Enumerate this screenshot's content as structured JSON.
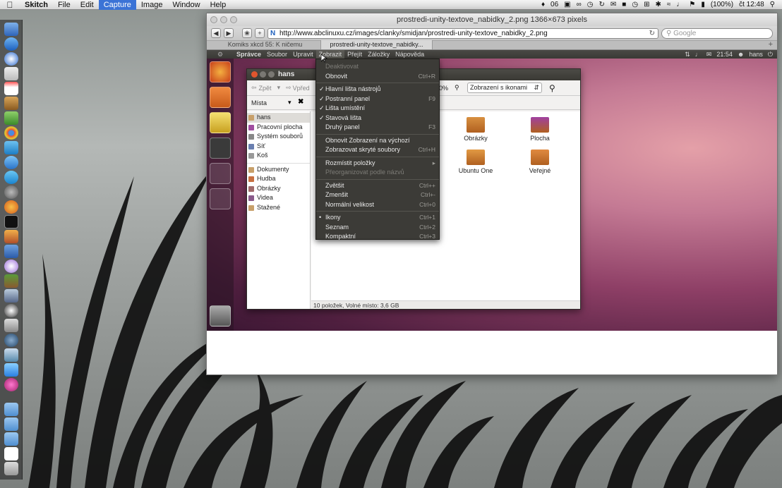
{
  "mac_menubar": {
    "app_name": "Skitch",
    "items": [
      "File",
      "Edit",
      "Capture",
      "Image",
      "Window",
      "Help"
    ],
    "active_item": "Capture",
    "status_battery": "(100%)",
    "status_time": "čt 12:48",
    "status_count": "06"
  },
  "browser": {
    "window_title": "prostredi-unity-textove_nabidky_2.png 1366×673 pixels",
    "url": "http://www.abclinuxu.cz/images/clanky/smidjan/prostredi-unity-textove_nabidky_2.png",
    "search_placeholder": "Google",
    "tabs": [
      {
        "label": "Komiks xkcd 55: K ničemu"
      },
      {
        "label": "prostredi-unity-textove_nabidky..."
      }
    ]
  },
  "ubuntu": {
    "panel_menus": [
      "Správce",
      "Soubor",
      "Upravit",
      "Zobrazit",
      "Přejít",
      "Záložky",
      "Nápověda"
    ],
    "panel_time": "21:54",
    "panel_user": "hans",
    "window_title": "hans",
    "toolbar": {
      "back": "Zpět",
      "forward": "Vpřed",
      "zoom": "100%",
      "view_mode": "Zobrazení s ikonami"
    },
    "sidebar_header": "Místa",
    "sidebar_items_top": [
      {
        "label": "hans",
        "color": "#c8a06a"
      },
      {
        "label": "Pracovní plocha",
        "color": "#a04da0"
      },
      {
        "label": "Systém souborů",
        "color": "#888"
      },
      {
        "label": "Síť",
        "color": "#6a7fb0"
      },
      {
        "label": "Koš",
        "color": "#999"
      }
    ],
    "sidebar_items_bottom": [
      {
        "label": "Dokumenty",
        "color": "#c8a06a"
      },
      {
        "label": "Hudba",
        "color": "#c87040"
      },
      {
        "label": "Obrázky",
        "color": "#a06a6a"
      },
      {
        "label": "Videa",
        "color": "#8a5a8a"
      },
      {
        "label": "Stažené",
        "color": "#c8a06a"
      }
    ],
    "folders": [
      {
        "label": "Obrázky",
        "color": "#d89040"
      },
      {
        "label": "Plocha",
        "color": "#a040a0"
      },
      {
        "label": "Ubuntu One",
        "color": "#e29a44"
      },
      {
        "label": "Veřejné",
        "color": "#e08a40"
      }
    ],
    "status": "10 položek, Volné místo: 3,6 GB",
    "menu": [
      {
        "label": "Deaktivovat",
        "shortcut": "",
        "mark": "",
        "disabled": true
      },
      {
        "label": "Obnovit",
        "shortcut": "Ctrl+R",
        "mark": "",
        "disabled": false
      },
      {
        "sep": true
      },
      {
        "label": "Hlavní lišta nástrojů",
        "shortcut": "",
        "mark": "✓",
        "disabled": false
      },
      {
        "label": "Postranní panel",
        "shortcut": "F9",
        "mark": "✓",
        "disabled": false
      },
      {
        "label": "Lišta umístění",
        "shortcut": "",
        "mark": "✓",
        "disabled": false
      },
      {
        "label": "Stavová lišta",
        "shortcut": "",
        "mark": "✓",
        "disabled": false
      },
      {
        "label": "Druhý panel",
        "shortcut": "F3",
        "mark": "",
        "disabled": false
      },
      {
        "sep": true
      },
      {
        "label": "Obnovit Zobrazení na výchozí",
        "shortcut": "",
        "mark": "",
        "disabled": false
      },
      {
        "label": "Zobrazovat skryté soubory",
        "shortcut": "Ctrl+H",
        "mark": "",
        "disabled": false
      },
      {
        "sep": true
      },
      {
        "label": "Rozmístit položky",
        "shortcut": "▸",
        "mark": "",
        "disabled": false
      },
      {
        "label": "Přeorganizovat podle názvů",
        "shortcut": "",
        "mark": "",
        "disabled": true
      },
      {
        "sep": true
      },
      {
        "label": "Zvětšit",
        "shortcut": "Ctrl++",
        "mark": "",
        "disabled": false
      },
      {
        "label": "Zmenšit",
        "shortcut": "Ctrl+-",
        "mark": "",
        "disabled": false
      },
      {
        "label": "Normální velikost",
        "shortcut": "Ctrl+0",
        "mark": "",
        "disabled": false
      },
      {
        "sep": true
      },
      {
        "label": "Ikony",
        "shortcut": "Ctrl+1",
        "mark": "•",
        "disabled": false
      },
      {
        "label": "Seznam",
        "shortcut": "Ctrl+2",
        "mark": "",
        "disabled": false
      },
      {
        "label": "Kompaktní",
        "shortcut": "Ctrl+3",
        "mark": "",
        "disabled": false
      }
    ]
  },
  "colors": {
    "mac_active": "#3b73d6",
    "ubuntu_panel": "#3c3b37",
    "ubuntu_menu": "#3c3b37"
  }
}
